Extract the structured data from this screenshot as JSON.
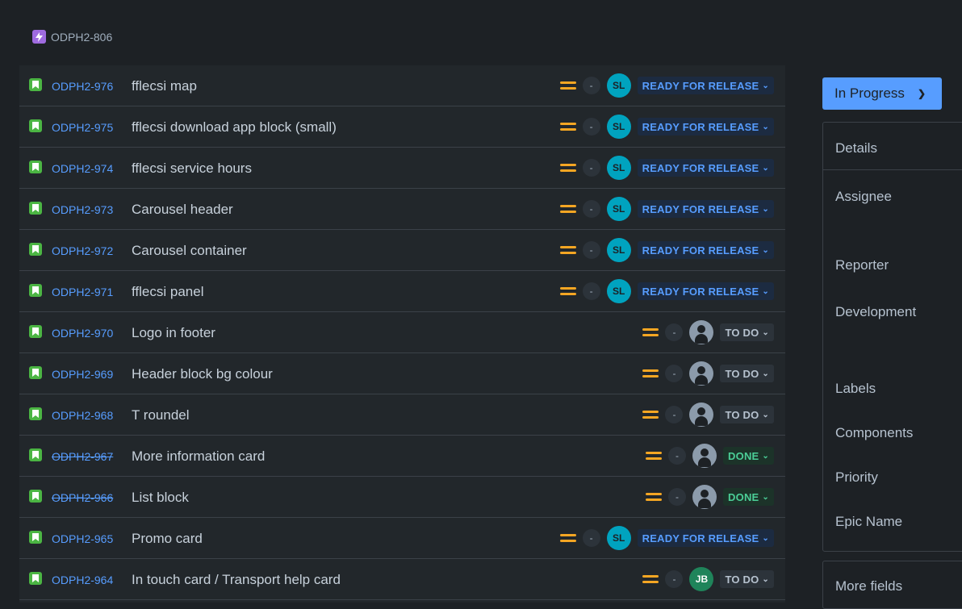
{
  "breadcrumb": {
    "epic_key": "ODPH2-806"
  },
  "issues": [
    {
      "key": "ODPH2-976",
      "summary": "fflecsi map",
      "estimate": "-",
      "assignee": "SL",
      "status": "READY FOR RELEASE",
      "status_type": "release",
      "done": false
    },
    {
      "key": "ODPH2-975",
      "summary": "fflecsi download app block (small)",
      "estimate": "-",
      "assignee": "SL",
      "status": "READY FOR RELEASE",
      "status_type": "release",
      "done": false
    },
    {
      "key": "ODPH2-974",
      "summary": "fflecsi service hours",
      "estimate": "-",
      "assignee": "SL",
      "status": "READY FOR RELEASE",
      "status_type": "release",
      "done": false
    },
    {
      "key": "ODPH2-973",
      "summary": "Carousel header",
      "estimate": "-",
      "assignee": "SL",
      "status": "READY FOR RELEASE",
      "status_type": "release",
      "done": false
    },
    {
      "key": "ODPH2-972",
      "summary": "Carousel container",
      "estimate": "-",
      "assignee": "SL",
      "status": "READY FOR RELEASE",
      "status_type": "release",
      "done": false
    },
    {
      "key": "ODPH2-971",
      "summary": "fflecsi panel",
      "estimate": "-",
      "assignee": "SL",
      "status": "READY FOR RELEASE",
      "status_type": "release",
      "done": false
    },
    {
      "key": "ODPH2-970",
      "summary": "Logo in footer",
      "estimate": "-",
      "assignee": "",
      "status": "TO DO",
      "status_type": "todo",
      "done": false
    },
    {
      "key": "ODPH2-969",
      "summary": "Header block bg colour",
      "estimate": "-",
      "assignee": "",
      "status": "TO DO",
      "status_type": "todo",
      "done": false
    },
    {
      "key": "ODPH2-968",
      "summary": "T roundel",
      "estimate": "-",
      "assignee": "",
      "status": "TO DO",
      "status_type": "todo",
      "done": false
    },
    {
      "key": "ODPH2-967",
      "summary": "More information card",
      "estimate": "-",
      "assignee": "",
      "status": "DONE",
      "status_type": "done",
      "done": true
    },
    {
      "key": "ODPH2-966",
      "summary": "List block",
      "estimate": "-",
      "assignee": "",
      "status": "DONE",
      "status_type": "done",
      "done": true
    },
    {
      "key": "ODPH2-965",
      "summary": "Promo card",
      "estimate": "-",
      "assignee": "SL",
      "status": "READY FOR RELEASE",
      "status_type": "release",
      "done": false
    },
    {
      "key": "ODPH2-964",
      "summary": "In touch card / Transport help card",
      "estimate": "-",
      "assignee": "JB",
      "status": "TO DO",
      "status_type": "todo",
      "done": false
    }
  ],
  "status_button": {
    "label": "In Progress"
  },
  "details": {
    "header": "Details",
    "fields": [
      "Assignee",
      "Reporter",
      "Development",
      "Labels",
      "Components",
      "Priority",
      "Epic Name"
    ]
  },
  "more_fields": {
    "label": "More fields"
  },
  "icons": {
    "epic": "lightning-icon",
    "story": "bookmark-icon",
    "priority": "priority-medium-icon",
    "chevron": "chevron-down-icon"
  },
  "colors": {
    "accent": "#579dff",
    "story": "#4bb543",
    "epic": "#9f6bdf",
    "priority_medium": "#f5a623"
  }
}
